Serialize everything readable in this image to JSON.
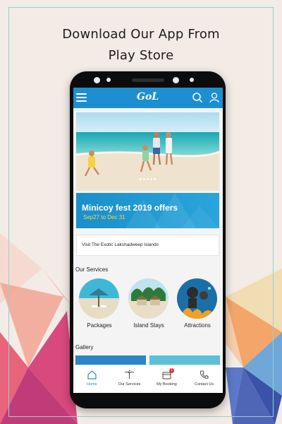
{
  "headline": {
    "line1": "Download Our App From",
    "line2": "Play Store"
  },
  "app": {
    "logo": "GoL",
    "promo": {
      "title": "Minicoy fest 2019 offers",
      "dates": "Sep27 to Dec 31"
    },
    "visit_text": "Visit The Exotic Lakshadweep Islands",
    "services_title": "Our Services",
    "services": [
      {
        "label": "Packages"
      },
      {
        "label": "Island Stays"
      },
      {
        "label": "Attractions"
      }
    ],
    "gallery_title": "Gallery",
    "bottom_nav": [
      {
        "label": "Home",
        "icon": "home-icon",
        "active": true
      },
      {
        "label": "Our Services",
        "icon": "palm-tree-icon"
      },
      {
        "label": "My Booking",
        "icon": "booking-icon",
        "badge": "1"
      },
      {
        "label": "Contact Us",
        "icon": "phone-icon"
      }
    ]
  },
  "colors": {
    "accent": "#1d8fd0",
    "promo_date": "#f5d64a",
    "badge": "#e0302b",
    "frame": "#8fd3d0"
  }
}
